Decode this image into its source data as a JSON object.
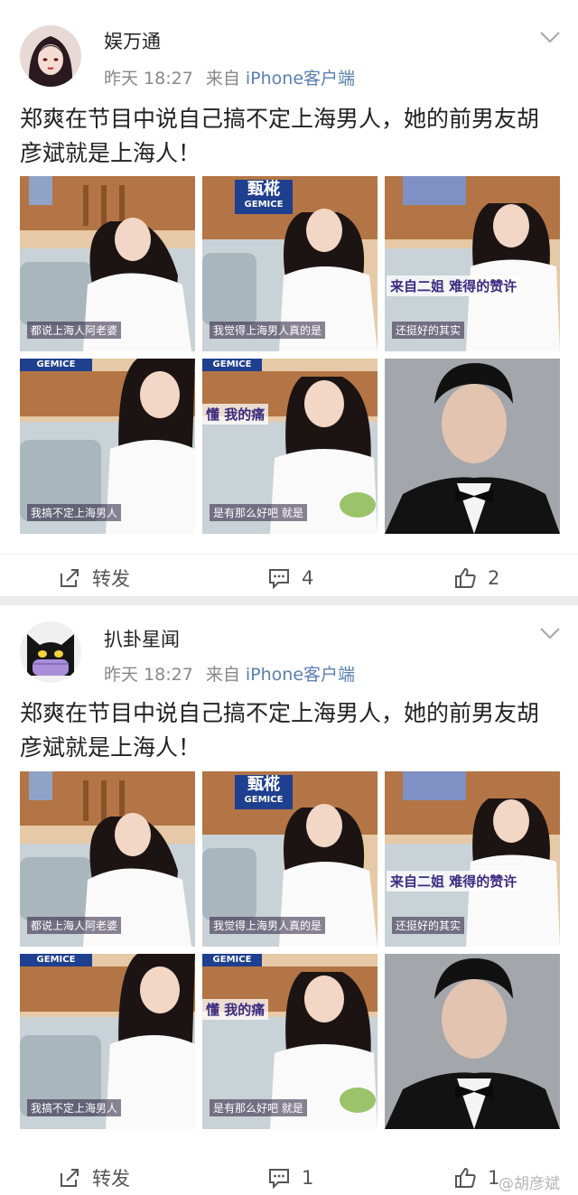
{
  "posts": [
    {
      "username": "娱万通",
      "time": "昨天 18:27",
      "source_prefix": "来自",
      "source_name": "iPhone客户端",
      "text": "郑爽在节目中说自己搞不定上海男人，她的前男友胡彦斌就是上海人！",
      "photos": [
        {
          "caption": "都说上海人阿老婆",
          "overlay": ""
        },
        {
          "caption": "我觉得上海男人真的是",
          "overlay": "",
          "sign": "甄椛",
          "sign_sub": "GEMICE"
        },
        {
          "caption": "还挺好的其实",
          "overlay": "来自二姐 难得的赞许"
        },
        {
          "caption": "我搞不定上海男人",
          "overlay": "",
          "sign": "GEMICE"
        },
        {
          "caption": "是有那么好吧 就是",
          "overlay": "懂 我的痛",
          "sign": "GEMICE"
        },
        {
          "caption": "",
          "overlay": ""
        }
      ],
      "repost_label": "转发",
      "comment_count": "4",
      "like_count": "2"
    },
    {
      "username": "扒卦星闻",
      "time": "昨天 18:27",
      "source_prefix": "来自",
      "source_name": "iPhone客户端",
      "text": "郑爽在节目中说自己搞不定上海男人，她的前男友胡彦斌就是上海人！",
      "photos": [
        {
          "caption": "都说上海人阿老婆",
          "overlay": ""
        },
        {
          "caption": "我觉得上海男人真的是",
          "overlay": "",
          "sign": "甄椛",
          "sign_sub": "GEMICE"
        },
        {
          "caption": "还挺好的其实",
          "overlay": "来自二姐 难得的赞许"
        },
        {
          "caption": "我搞不定上海男人",
          "overlay": "",
          "sign": "GEMICE"
        },
        {
          "caption": "是有那么好吧 就是",
          "overlay": "懂 我的痛",
          "sign": "GEMICE"
        },
        {
          "caption": "",
          "overlay": ""
        }
      ],
      "repost_label": "转发",
      "comment_count": "1",
      "like_count": "1"
    }
  ],
  "watermark": "@胡彦斌",
  "colors": {
    "source_link": "#5a7fb0",
    "brand_blue": "#1f3f8f",
    "icon": "#555555"
  }
}
